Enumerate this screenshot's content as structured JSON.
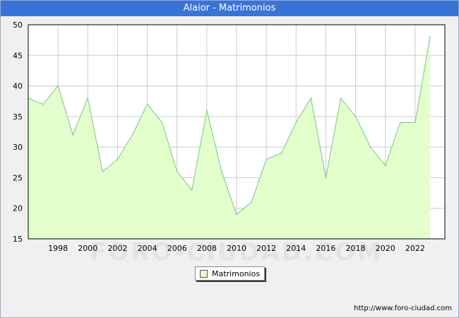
{
  "title": "Alaior - Matrimonios",
  "footer_url": "http://www.foro-ciudad.com",
  "watermark": "FORO-CIUDAD.COM",
  "colors": {
    "title_bar": "#3a73d6",
    "series_fill": "#e2ffcc",
    "series_line": "#7fc28f",
    "grid": "#cccccc",
    "plot_bg": "#ffffff"
  },
  "chart_data": {
    "type": "area",
    "title": "Alaior - Matrimonios",
    "xlabel": "",
    "ylabel": "",
    "x": [
      1996,
      1997,
      1998,
      1999,
      2000,
      2001,
      2002,
      2003,
      2004,
      2005,
      2006,
      2007,
      2008,
      2009,
      2010,
      2011,
      2012,
      2013,
      2014,
      2015,
      2016,
      2017,
      2018,
      2019,
      2020,
      2021,
      2022,
      2023
    ],
    "series": [
      {
        "name": "Matrimonios",
        "values": [
          38,
          37,
          40,
          32,
          38,
          26,
          28,
          32,
          37,
          34,
          26,
          23,
          36,
          26,
          19,
          21,
          28,
          29,
          34,
          38,
          25,
          38,
          35,
          30,
          27,
          34,
          34,
          48
        ]
      }
    ],
    "xlim": [
      1996,
      2024
    ],
    "ylim": [
      15,
      50
    ],
    "yticks": [
      15,
      20,
      25,
      30,
      35,
      40,
      45,
      50
    ],
    "xticks": [
      1998,
      2000,
      2002,
      2004,
      2006,
      2008,
      2010,
      2012,
      2014,
      2016,
      2018,
      2020,
      2022
    ],
    "grid": true,
    "legend_position": "bottom-center"
  }
}
